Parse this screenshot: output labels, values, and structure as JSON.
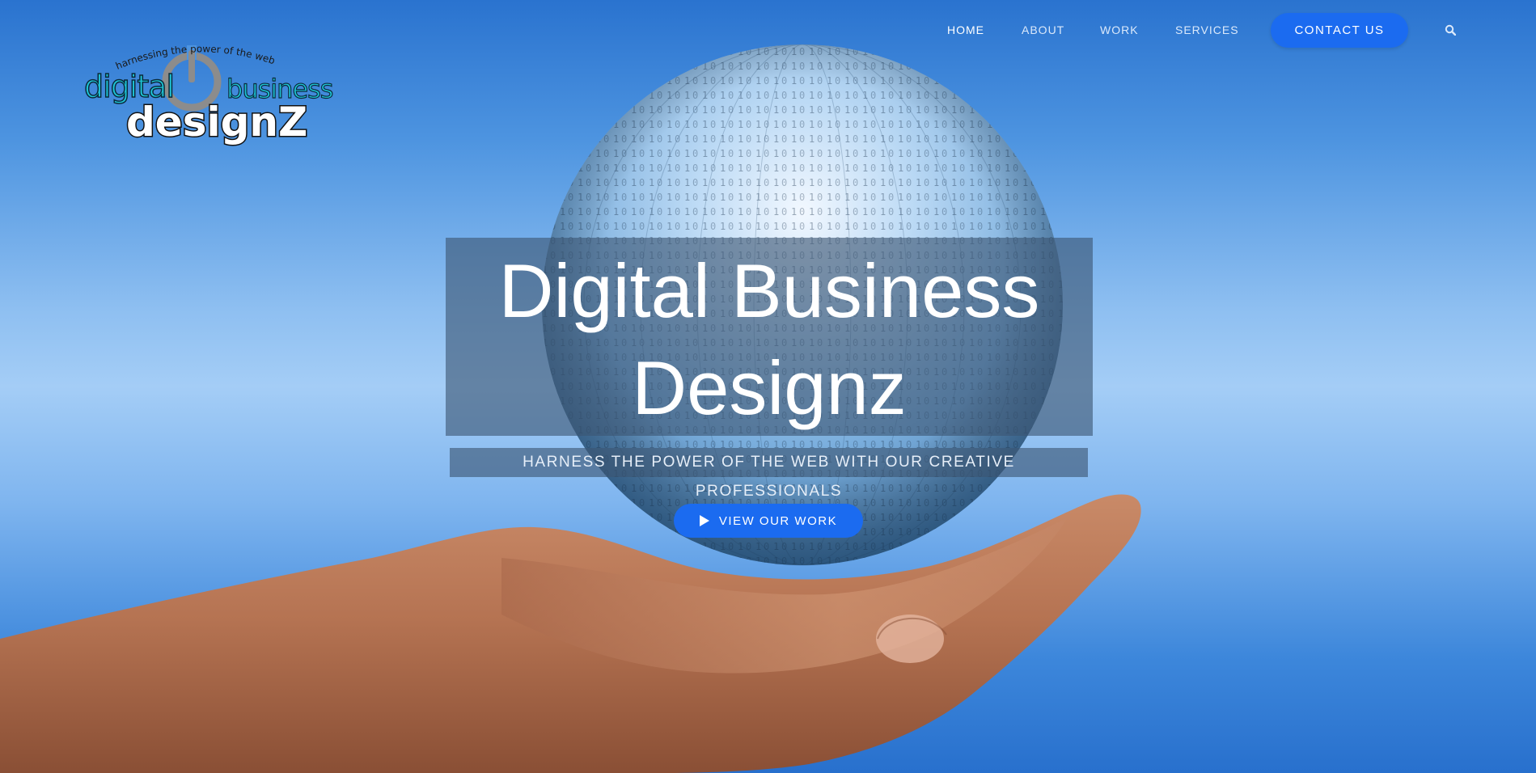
{
  "brand": {
    "logo_tagline": "harnessing the power of the web",
    "logo_word_left": "digital",
    "logo_word_right": "business",
    "logo_word_main": "designZ"
  },
  "nav": {
    "items": [
      {
        "label": "HOME",
        "active": true
      },
      {
        "label": "ABOUT",
        "active": false
      },
      {
        "label": "WORK",
        "active": false
      },
      {
        "label": "SERVICES",
        "active": false
      }
    ],
    "contact_label": "CONTACT US",
    "search_icon": "search-icon"
  },
  "hero": {
    "title_line1": "Digital Business",
    "title_line2": "Designz",
    "subtitle": "HARNESS THE POWER OF THE WEB WITH OUR CREATIVE PROFESSIONALS",
    "cta_label": "VIEW OUR WORK",
    "cta_icon": "play-icon"
  },
  "colors": {
    "accent": "#1b6bf0",
    "overlay": "#3c5573",
    "logo_cyan": "#1ec5d6"
  }
}
